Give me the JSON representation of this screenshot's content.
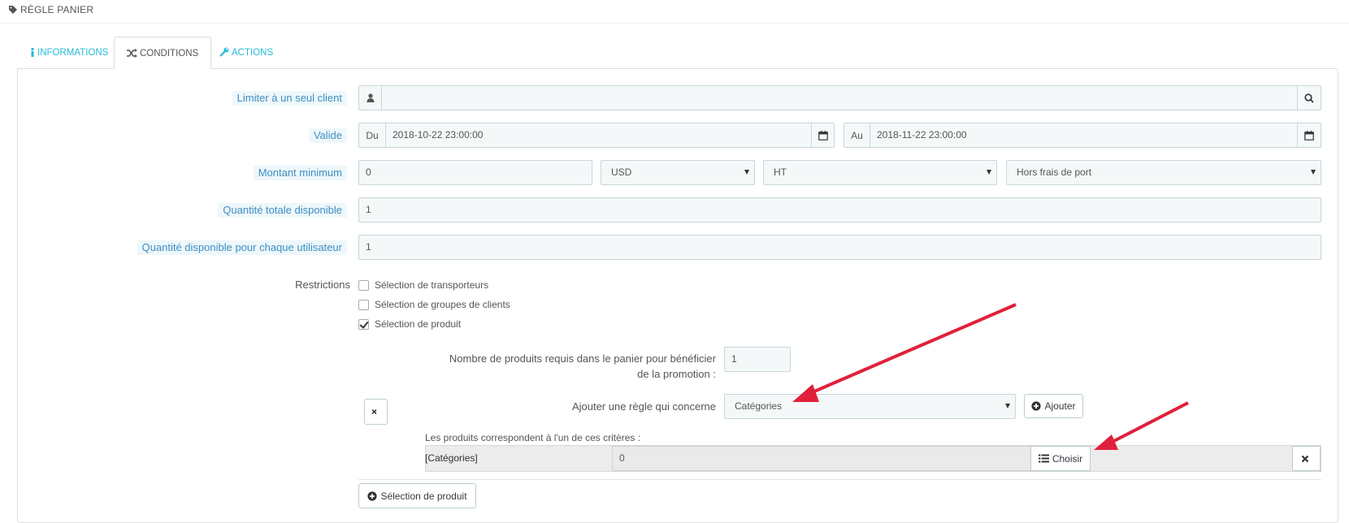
{
  "header": {
    "title": "RÈGLE PANIER",
    "icon": "tag-icon"
  },
  "tabs": [
    {
      "label": "INFORMATIONS",
      "icon": "info-icon",
      "active": false
    },
    {
      "label": "CONDITIONS",
      "icon": "shuffle-icon",
      "active": true
    },
    {
      "label": "ACTIONS",
      "icon": "wrench-icon",
      "active": false
    }
  ],
  "form": {
    "customer": {
      "label": "Limiter à un seul client",
      "value": ""
    },
    "valid": {
      "label": "Valide",
      "from_prefix": "Du",
      "from_value": "2018-10-22 23:00:00",
      "to_prefix": "Au",
      "to_value": "2018-11-22 23:00:00"
    },
    "min_amount": {
      "label": "Montant minimum",
      "value": "0",
      "currency": "USD",
      "tax": "HT",
      "shipping": "Hors frais de port"
    },
    "total_qty": {
      "label": "Quantité totale disponible",
      "value": "1"
    },
    "user_qty": {
      "label": "Quantité disponible pour chaque utilisateur",
      "value": "1"
    },
    "restrictions": {
      "label": "Restrictions",
      "items": [
        {
          "label": "Sélection de transporteurs",
          "checked": false
        },
        {
          "label": "Sélection de groupes de clients",
          "checked": false
        },
        {
          "label": "Sélection de produit",
          "checked": true
        }
      ]
    },
    "product_rule": {
      "required_label_line1": "Nombre de produits requis dans le panier pour bénéficier",
      "required_label_line2": "de la promotion :",
      "required_value": "1",
      "add_rule_label": "Ajouter une règle qui concerne",
      "add_rule_select": "Catégories",
      "add_button": "Ajouter",
      "criteria_note": "Les produits correspondent à l'un de ces critères :",
      "criteria_type": "[Catégories]",
      "criteria_value": "0",
      "choose_button": "Choisir",
      "add_selection_button": "Sélection de produit"
    }
  },
  "colors": {
    "accent": "#25b9d7",
    "arrow": "#e0203a",
    "label_bg": "#eef7fa"
  }
}
